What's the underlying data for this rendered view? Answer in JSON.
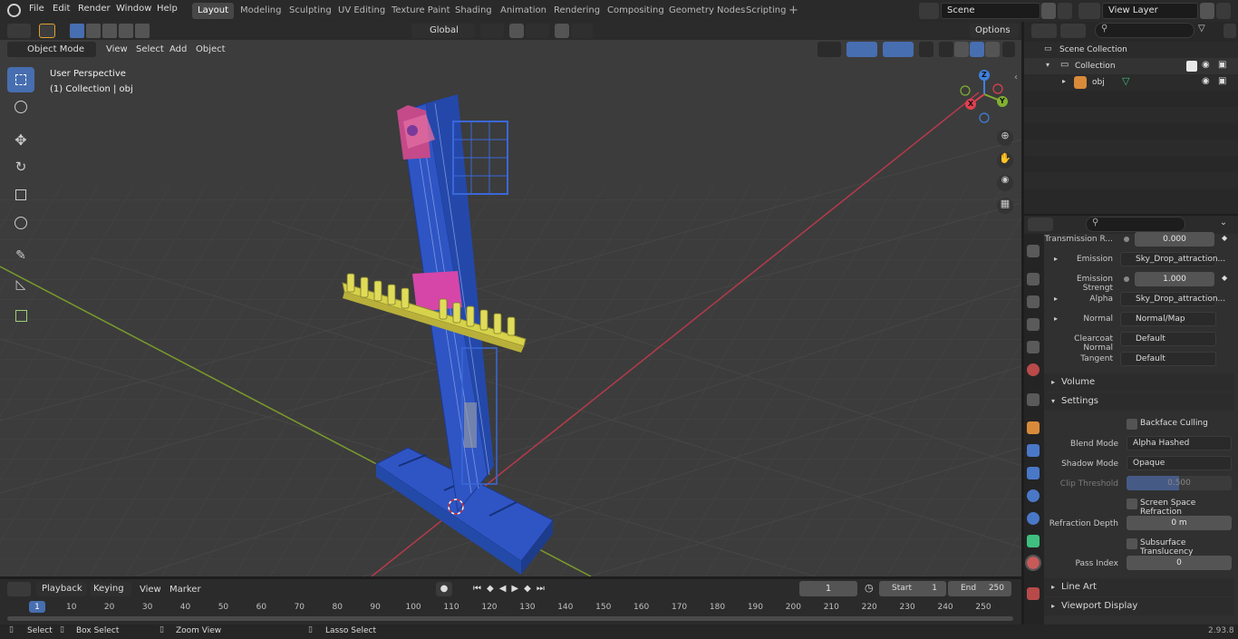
{
  "menu": {
    "file": "File",
    "edit": "Edit",
    "render": "Render",
    "window": "Window",
    "help": "Help"
  },
  "workspaces": [
    "Layout",
    "Modeling",
    "Sculpting",
    "UV Editing",
    "Texture Paint",
    "Shading",
    "Animation",
    "Rendering",
    "Compositing",
    "Geometry Nodes",
    "Scripting"
  ],
  "scene": {
    "name": "Scene",
    "view_layer": "View Layer"
  },
  "viewport": {
    "mode": "Object Mode",
    "view": "View",
    "select": "Select",
    "add": "Add",
    "object": "Object",
    "transform": "Global",
    "options": "Options",
    "overlay_title": "User Perspective",
    "overlay_collection": "(1) Collection | obj",
    "gizmo": {
      "z": "Z",
      "y": "Y",
      "x": "X"
    }
  },
  "outliner": {
    "scene_collection": "Scene Collection",
    "collection": "Collection",
    "obj": "obj"
  },
  "properties": {
    "transmission_label": "Transmission R...",
    "transmission_value": "0.000",
    "emission_label": "Emission",
    "emission_value": "Sky_Drop_attraction...",
    "emission_strength_label": "Emission Strengt",
    "emission_strength_value": "1.000",
    "alpha_label": "Alpha",
    "alpha_value": "Sky_Drop_attraction...",
    "normal_label": "Normal",
    "normal_value": "Normal/Map",
    "clearcoat_label": "Clearcoat Normal",
    "clearcoat_value": "Default",
    "tangent_label": "Tangent",
    "tangent_value": "Default",
    "volume": "Volume",
    "settings": "Settings",
    "backface": "Backface Culling",
    "blend_label": "Blend Mode",
    "blend_value": "Alpha Hashed",
    "shadow_label": "Shadow Mode",
    "shadow_value": "Opaque",
    "clip_label": "Clip Threshold",
    "clip_value": "0.500",
    "clip_fill": 0.5,
    "ssr": "Screen Space Refraction",
    "refraction_label": "Refraction Depth",
    "refraction_value": "0 m",
    "subsurface": "Subsurface Translucency",
    "pass_label": "Pass Index",
    "pass_value": "0",
    "line_art": "Line Art",
    "viewport_display": "Viewport Display"
  },
  "timeline": {
    "playback": "Playback",
    "keying": "Keying",
    "view": "View",
    "marker": "Marker",
    "current_frame": "1",
    "start_label": "Start",
    "start": "1",
    "end_label": "End",
    "end": "250",
    "ticks": [
      "1",
      "10",
      "20",
      "30",
      "40",
      "50",
      "60",
      "70",
      "80",
      "90",
      "100",
      "110",
      "120",
      "130",
      "140",
      "150",
      "160",
      "170",
      "180",
      "190",
      "200",
      "210",
      "220",
      "230",
      "240",
      "250"
    ]
  },
  "status": {
    "select": "Select",
    "box_select": "Box Select",
    "zoom": "Zoom View",
    "lasso": "Lasso Select",
    "version": "2.93.8"
  },
  "colors": {
    "accent": "#476eb0",
    "tower": "#2f55c4",
    "seats": "#d6d24a",
    "pink": "#d646a8",
    "xaxis": "#b63a4a",
    "yaxis": "#7a9a2c"
  }
}
